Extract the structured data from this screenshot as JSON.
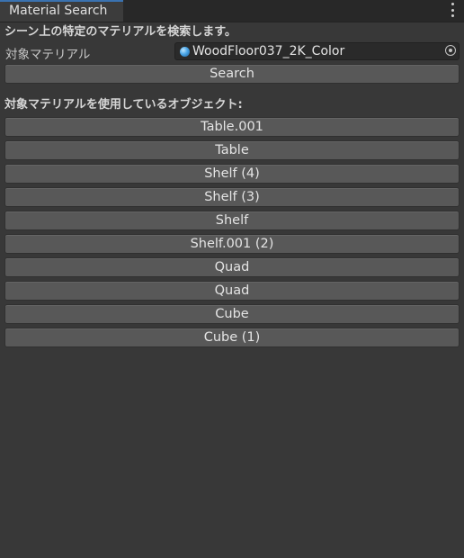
{
  "window": {
    "tab_title": "Material Search",
    "menu_icon": "kebab-menu-icon"
  },
  "description": "シーン上の特定のマテリアルを検索します。",
  "target_field": {
    "label": "対象マテリアル",
    "value": "WoodFloor037_2K_Color",
    "icon": "material-sphere-icon",
    "picker_icon": "object-picker-icon"
  },
  "search_button": {
    "label": "Search"
  },
  "results": {
    "title": "対象マテリアルを使用しているオブジェクト:",
    "items": [
      {
        "label": "Table.001"
      },
      {
        "label": "Table"
      },
      {
        "label": "Shelf (4)"
      },
      {
        "label": "Shelf (3)"
      },
      {
        "label": "Shelf"
      },
      {
        "label": "Shelf.001 (2)"
      },
      {
        "label": "Quad"
      },
      {
        "label": "Quad"
      },
      {
        "label": "Cube"
      },
      {
        "label": "Cube (1)"
      }
    ]
  },
  "colors": {
    "background": "#383838",
    "button": "#585858",
    "field": "#2a2a2a",
    "tab_accent": "#3a72b0"
  }
}
